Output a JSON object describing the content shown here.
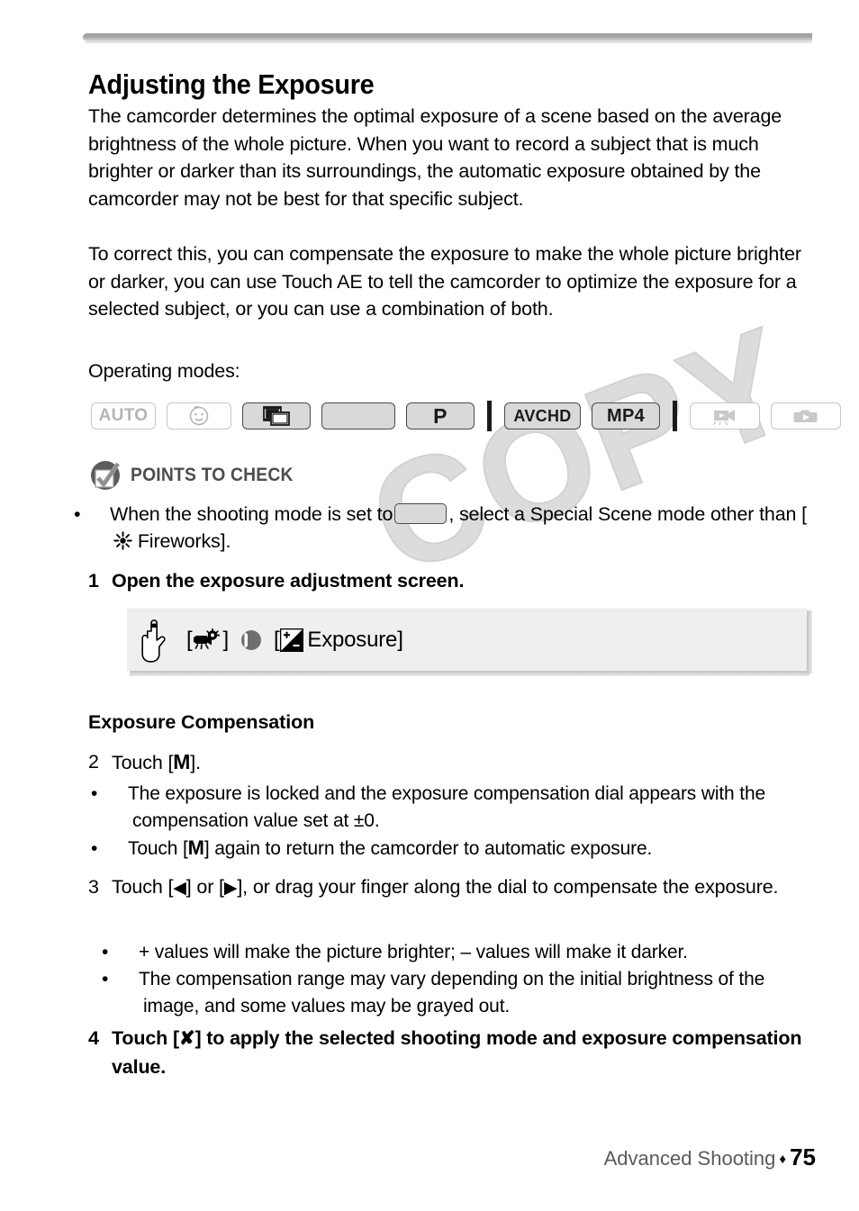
{
  "title": "Adjusting the Exposure",
  "paragraphs": {
    "intro": "The camcorder determines the optimal exposure of a scene based on the average brightness of the whole picture. When you want to record a subject that is much brighter or darker than its surroundings, the automatic exposure obtained by the camcorder may not be best for that specific subject.",
    "correct": "To correct this, you can compensate the exposure to make the whole picture brighter or darker, you can use Touch AE to tell the camcorder to optimize the exposure for a selected subject, or you can use a combination of both.",
    "operating_modes_label": "Operating modes:"
  },
  "mode_badges": [
    {
      "name": "auto",
      "label": "AUTO",
      "icon": "",
      "state": "off"
    },
    {
      "name": "baby",
      "label": "",
      "icon": "baby-face-icon",
      "state": "off"
    },
    {
      "name": "cinema",
      "label": "",
      "icon": "cinema-film-icon",
      "state": "on"
    },
    {
      "name": "blank-mode",
      "label": "",
      "icon": "",
      "state": "on"
    },
    {
      "name": "program",
      "label": "P",
      "icon": "",
      "state": "on"
    },
    {
      "name": "avchd",
      "label": "AVCHD",
      "icon": "",
      "state": "on"
    },
    {
      "name": "mp4",
      "label": "MP4",
      "icon": "",
      "state": "on"
    },
    {
      "name": "movie-playback",
      "label": "",
      "icon": "movie-playback-icon",
      "state": "off"
    },
    {
      "name": "photo-playback",
      "label": "",
      "icon": "photo-playback-icon",
      "state": "off"
    }
  ],
  "points_to_check": {
    "heading": "POINTS TO CHECK",
    "bullet_part1": "When the shooting mode is set to",
    "bullet_part2": ", select a Special Scene mode other than [",
    "fireworks_label": "Fireworks].",
    "icon": "fireworks-icon"
  },
  "steps": {
    "step1": {
      "num": "1",
      "text": "Open the exposure adjustment screen."
    },
    "step2": {
      "num": "2",
      "text_before": "Touch [",
      "symbol": "M",
      "text_after": "]."
    },
    "step2_bullets": [
      "The exposure is locked and the exposure compensation dial appears with the compensation value set at ±0.",
      "Touch [M] again to return the camcorder to automatic exposure."
    ],
    "step2_bullet2": {
      "before": "Touch [",
      "symbol": "M",
      "after": "] again to return the camcorder to automatic exposure."
    },
    "step3": {
      "num": "3",
      "before": "Touch [",
      "left_arrow": "◀",
      "middle": "] or [",
      "right_arrow": "▶",
      "after": "], or drag your finger along the dial to compensate the exposure."
    },
    "step3_bullets": [
      "+ values will make the picture brighter; – values will make it darker.",
      "The compensation range may vary depending on the initial brightness of the image, and some values may be grayed out."
    ],
    "step4": {
      "num": "4",
      "before": "Touch [",
      "symbol": "✘",
      "after": "] to apply the selected shooting mode and exposure compensation value."
    }
  },
  "callout": {
    "hand_icon": "pointing-hand-icon",
    "open_bracket1": "[",
    "menu_icon": "camcorder-menu-icon",
    "close_bracket1": "]",
    "arrow_icon": "arrow-right-circle-icon",
    "open_bracket2": "[",
    "exposure_icon": "exposure-compensation-icon",
    "exposure_label": "Exposure]"
  },
  "section_heading": "Exposure Compensation",
  "footer": {
    "chapter": "Advanced Shooting",
    "separator": "♦",
    "page": "75"
  },
  "watermark": {
    "text": "COPY"
  },
  "colors": {
    "badge_active_bg": "#d9d9d9",
    "badge_active_border": "#4b4b4b",
    "badge_inactive_border": "#c6c6c6",
    "badge_inactive_text": "#b4b4b4",
    "callout_bg": "#efefef",
    "ptc_gray": "#4d4d4d",
    "watermark_gray": "#dcdcdc",
    "footer_gray": "#5a5a5a"
  }
}
